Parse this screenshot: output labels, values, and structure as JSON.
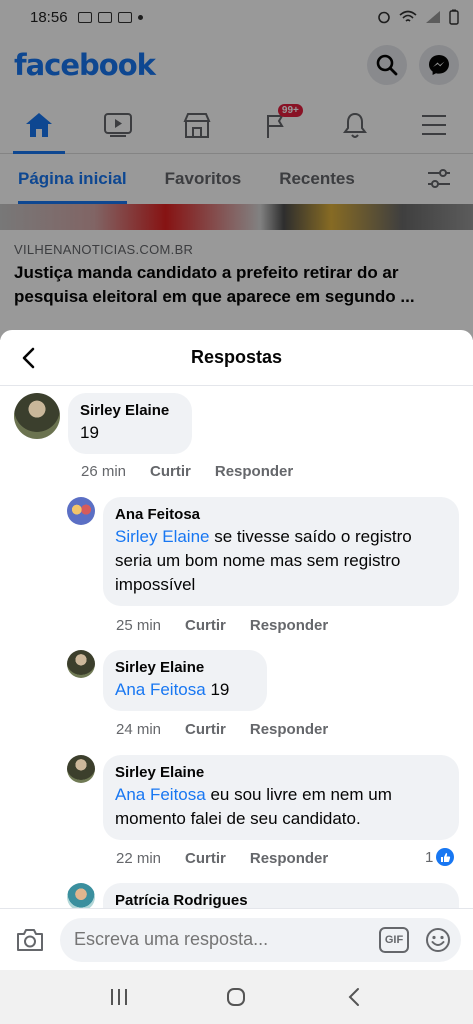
{
  "status_bar": {
    "time": "18:56"
  },
  "app": {
    "logo": "facebook"
  },
  "nav": {
    "badge": "99+"
  },
  "subtabs": [
    "Página inicial",
    "Favoritos",
    "Recentes"
  ],
  "feed": {
    "source": "VILHENANOTICIAS.COM.BR",
    "title": "Justiça manda candidato a prefeito retirar do ar pesquisa eleitoral em que aparece em segundo ..."
  },
  "sheet": {
    "title": "Respostas"
  },
  "comments": [
    {
      "author": "Sirley Elaine",
      "mention": "",
      "text": "19",
      "time": "26 min",
      "like": "Curtir",
      "reply": "Responder"
    },
    {
      "author": "Ana Feitosa",
      "mention": "Sirley Elaine",
      "text": " se tivesse saído o registro seria um bom nome mas sem registro impossível",
      "time": "25 min",
      "like": "Curtir",
      "reply": "Responder"
    },
    {
      "author": "Sirley Elaine",
      "mention": "Ana Feitosa",
      "text": " 19",
      "time": "24 min",
      "like": "Curtir",
      "reply": "Responder"
    },
    {
      "author": "Sirley Elaine",
      "mention": "Ana Feitosa",
      "text": " eu sou livre em nem um momento falei de seu candidato.",
      "time": "22 min",
      "like": "Curtir",
      "reply": "Responder",
      "reactions": "1"
    },
    {
      "author": "Patrícia Rodrigues"
    }
  ],
  "composer": {
    "placeholder": "Escreva uma resposta...",
    "gif_label": "GIF"
  },
  "colors": {
    "accent": "#1877f2",
    "bubble": "#f0f2f5",
    "secondary_text": "#65676b"
  },
  "icons": [
    "search-icon",
    "messenger-icon",
    "home-icon",
    "watch-icon",
    "marketplace-icon",
    "pages-icon",
    "bell-icon",
    "menu-icon",
    "filter-icon",
    "back-icon",
    "camera-icon",
    "gif-icon",
    "emoji-icon",
    "like-icon",
    "recents-icon",
    "home-circle-icon",
    "back-triangle-icon"
  ]
}
